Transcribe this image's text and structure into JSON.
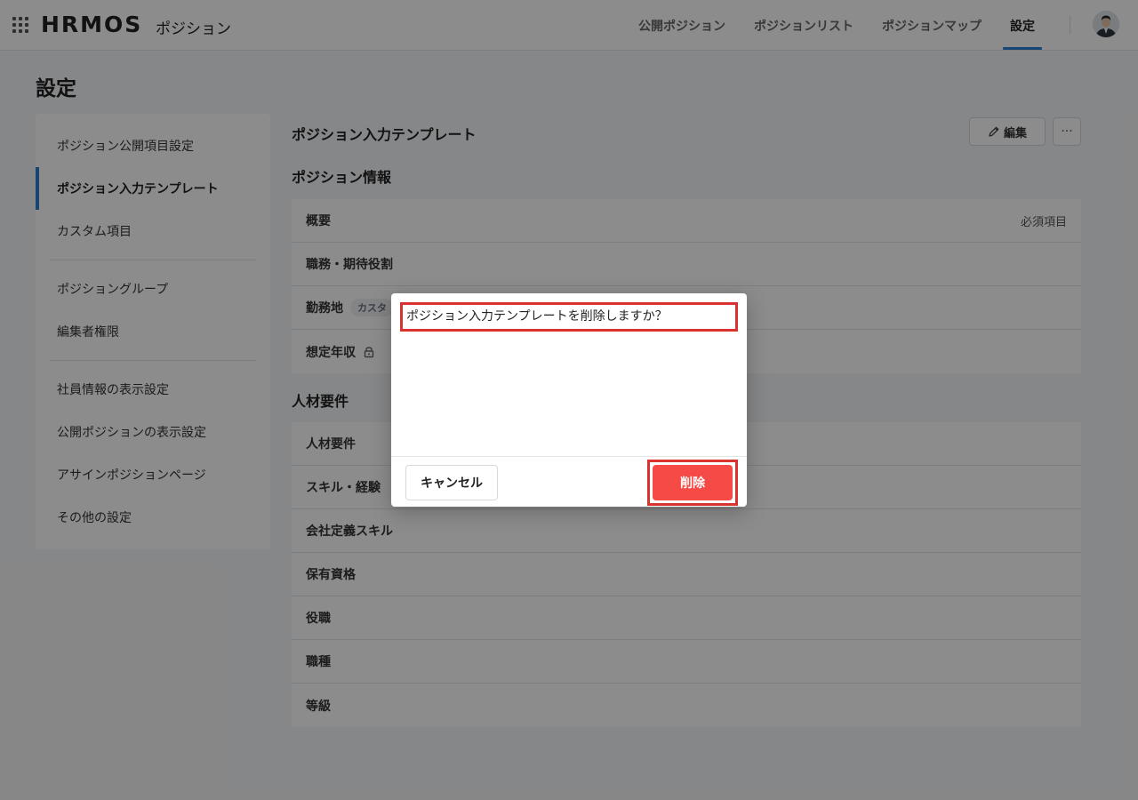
{
  "header": {
    "logo": "HRMOS",
    "product": "ポジション",
    "nav": [
      {
        "label": "公開ポジション"
      },
      {
        "label": "ポジションリスト"
      },
      {
        "label": "ポジションマップ"
      },
      {
        "label": "設定"
      }
    ],
    "active_nav": "設定"
  },
  "page": {
    "title": "設定"
  },
  "sidebar": {
    "groups": [
      [
        "ポジション公開項目設定",
        "ポジション入力テンプレート",
        "カスタム項目"
      ],
      [
        "ポジショングループ",
        "編集者権限"
      ],
      [
        "社員情報の表示設定",
        "公開ポジションの表示設定",
        "アサインポジションページ",
        "その他の設定"
      ]
    ],
    "active": "ポジション入力テンプレート"
  },
  "main": {
    "title": "ポジション入力テンプレート",
    "edit_label": "編集",
    "more_label": "···",
    "sections": [
      {
        "title": "ポジション情報",
        "rows": [
          {
            "label": "概要",
            "required": "必須項目"
          },
          {
            "label": "職務・期待役割"
          },
          {
            "label": "勤務地",
            "badge": "カスタ"
          },
          {
            "label": "想定年収",
            "lock": true
          }
        ]
      },
      {
        "title": "人材要件",
        "rows": [
          {
            "label": "人材要件"
          },
          {
            "label": "スキル・経験"
          },
          {
            "label": "会社定義スキル"
          },
          {
            "label": "保有資格"
          },
          {
            "label": "役職"
          },
          {
            "label": "職種"
          },
          {
            "label": "等級"
          }
        ]
      }
    ]
  },
  "modal": {
    "message": "ポジション入力テンプレートを削除しますか？",
    "cancel_label": "キャンセル",
    "delete_label": "削除"
  },
  "colors": {
    "accent": "#2a7fd4",
    "danger": "#f54a45",
    "highlight": "#d9332f"
  }
}
